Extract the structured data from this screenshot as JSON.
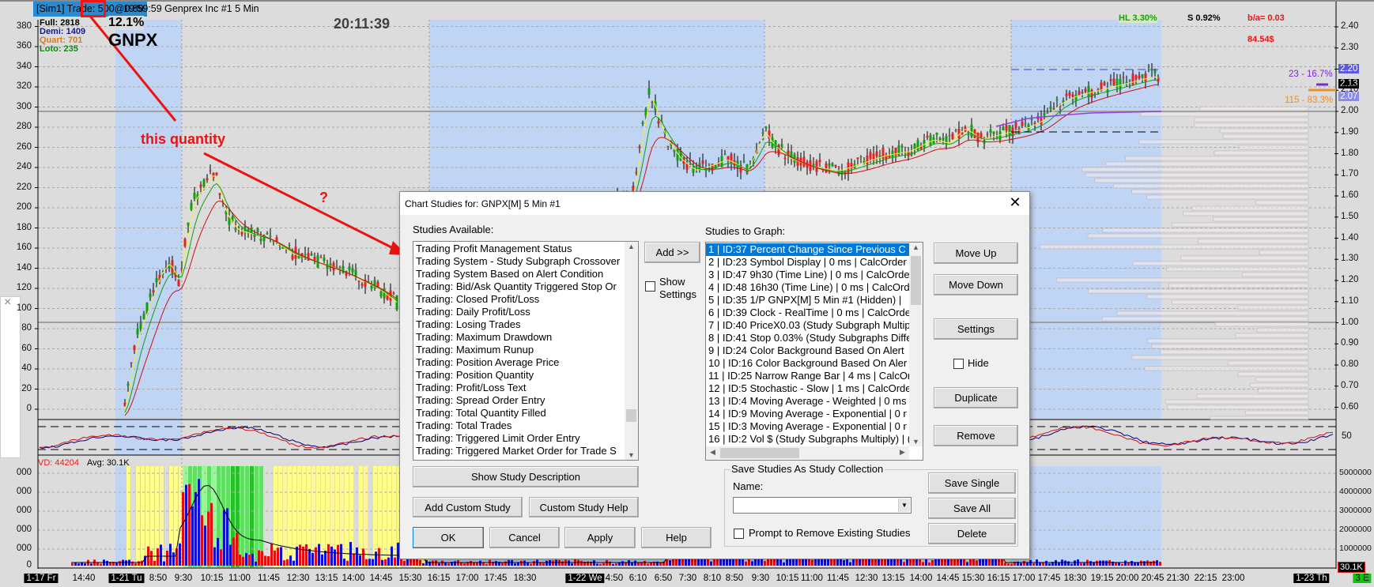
{
  "title_bar": {
    "trade_label": "[Sim1]  Trade: 500@0.89",
    "info": "19:59:59 Genprex Inc #1 5 Min"
  },
  "position_sizes": {
    "full": "Full: 2818",
    "demi": "Demi: 1409",
    "quart": "Quart: 701",
    "loto": "Loto: 235"
  },
  "symbol_overlay": {
    "percent": "12.1%",
    "symbol": "GNPX"
  },
  "clock": "20:11:39",
  "stats": {
    "hl": "HL 3.30%",
    "s": "S 0.92%",
    "ba": "b/a= 0.03",
    "dollars": "84.54$",
    "upper_pct": "23 - 16.7%",
    "lower_pct": "115 - 83.3%"
  },
  "annotations": {
    "label": "this quantity",
    "question": "?"
  },
  "left_axis": [
    "380",
    "360",
    "340",
    "320",
    "300",
    "280",
    "260",
    "240",
    "220",
    "200",
    "180",
    "160",
    "140",
    "120",
    "100",
    "80",
    "60",
    "40",
    "20",
    "0"
  ],
  "right_axis": [
    "2.40",
    "2.30",
    "2.20",
    "2.10",
    "2.00",
    "1.90",
    "1.80",
    "1.70",
    "1.60",
    "1.50",
    "1.40",
    "1.30",
    "1.20",
    "1.10",
    "1.00",
    "0.90",
    "0.80",
    "0.70",
    "0.60"
  ],
  "price_markers": {
    "high": "2.20",
    "last": "2.13",
    "low": "2.07"
  },
  "oscillator_axis": "50",
  "volume_pane": {
    "vd": "VD: 44204",
    "avg": "Avg: 30.1K",
    "axis": [
      "5000000",
      "4000000",
      "3000000",
      "2000000",
      "1000000"
    ],
    "left_axis": [
      "000",
      "000",
      "000",
      "000",
      "000",
      "0"
    ],
    "current": "30.1K"
  },
  "time_axis": [
    "1-17 Fr",
    "14:40",
    "1-21 Tu",
    "8:50",
    "9:30",
    "10:15",
    "11:00",
    "11:45",
    "12:30",
    "13:15",
    "14:00",
    "14:45",
    "15:30",
    "16:15",
    "17:00",
    "17:45",
    "18:30",
    "1-22 We",
    "4:50",
    "6:10",
    "6:50",
    "7:30",
    "8:10",
    "8:50",
    "9:30",
    "10:15",
    "11:00",
    "11:45",
    "12:30",
    "13:15",
    "14:00",
    "14:45",
    "15:30",
    "16:15",
    "17:00",
    "17:45",
    "18:30",
    "19:15",
    "20:00",
    "20:45",
    "21:30",
    "22:15",
    "23:00",
    "1-23 Th",
    "3 E"
  ],
  "colors": {
    "accent": "#0078d7",
    "band": "#c0d4f4",
    "up": "#10a010",
    "down": "#e82020",
    "annotation": "#ee1111"
  },
  "dialog": {
    "title": "Chart Studies for: GNPX[M]  5 Min   #1",
    "available_label": "Studies Available:",
    "available": [
      "Trading Profit Management Status",
      "Trading System - Study Subgraph Crossover",
      "Trading System Based on Alert Condition",
      "Trading: Bid/Ask Quantity Triggered Stop Or",
      "Trading: Closed Profit/Loss",
      "Trading: Daily Profit/Loss",
      "Trading: Losing Trades",
      "Trading: Maximum Drawdown",
      "Trading: Maximum Runup",
      "Trading: Position Average Price",
      "Trading: Position Quantity",
      "Trading: Profit/Loss Text",
      "Trading: Spread Order Entry",
      "Trading: Total Quantity Filled",
      "Trading: Total Trades",
      "Trading: Triggered Limit Order Entry",
      "Trading: Triggered Market Order for Trade S"
    ],
    "add": "Add >>",
    "show_settings": "Show Settings",
    "graph_label": "Studies to Graph:",
    "graph": [
      "1 | ID:37  Percent Change Since Previous C",
      "2 | ID:23  Symbol Display | 0 ms | CalcOrder",
      "3 | ID:47  9h30 (Time Line) | 0 ms | CalcOrder",
      "4 | ID:48  16h30 (Time Line) | 0 ms | CalcOrde",
      "5 | ID:35  1/P GNPX[M]  5 Min  #1 (Hidden) |",
      "6 | ID:39  Clock - RealTime | 0 ms | CalcOrde",
      "7 | ID:40  PriceX0.03 (Study Subgraph Multip",
      "8 | ID:41  Stop 0.03% (Study Subgraphs Diffe",
      "9 | ID:24  Color Background Based On Alert",
      "10 | ID:16  Color Background Based On Aler",
      "11 | ID:25  Narrow Range Bar | 4 ms | CalcOr",
      "12 | ID:5  Stochastic - Slow | 1 ms | CalcOrde",
      "13 | ID:4  Moving Average - Weighted | 0 ms",
      "14 | ID:9  Moving Average - Exponential | 0 r",
      "15 | ID:3  Moving Average - Exponential | 0 r",
      "16 | ID:2  Vol $ (Study Subgraphs Multiply) | ("
    ],
    "move_up": "Move Up",
    "move_down": "Move Down",
    "settings": "Settings",
    "hide": "Hide",
    "duplicate": "Duplicate",
    "remove": "Remove",
    "show_description": "Show Study Description",
    "add_custom": "Add Custom Study",
    "custom_help": "Custom Study Help",
    "ok": "OK",
    "cancel": "Cancel",
    "apply": "Apply",
    "help": "Help",
    "collection": {
      "legend": "Save Studies As Study Collection",
      "name_label": "Name:",
      "name_value": "",
      "prompt": "Prompt to Remove Existing Studies",
      "save_single": "Save Single",
      "save_all": "Save All",
      "delete": "Delete"
    }
  }
}
